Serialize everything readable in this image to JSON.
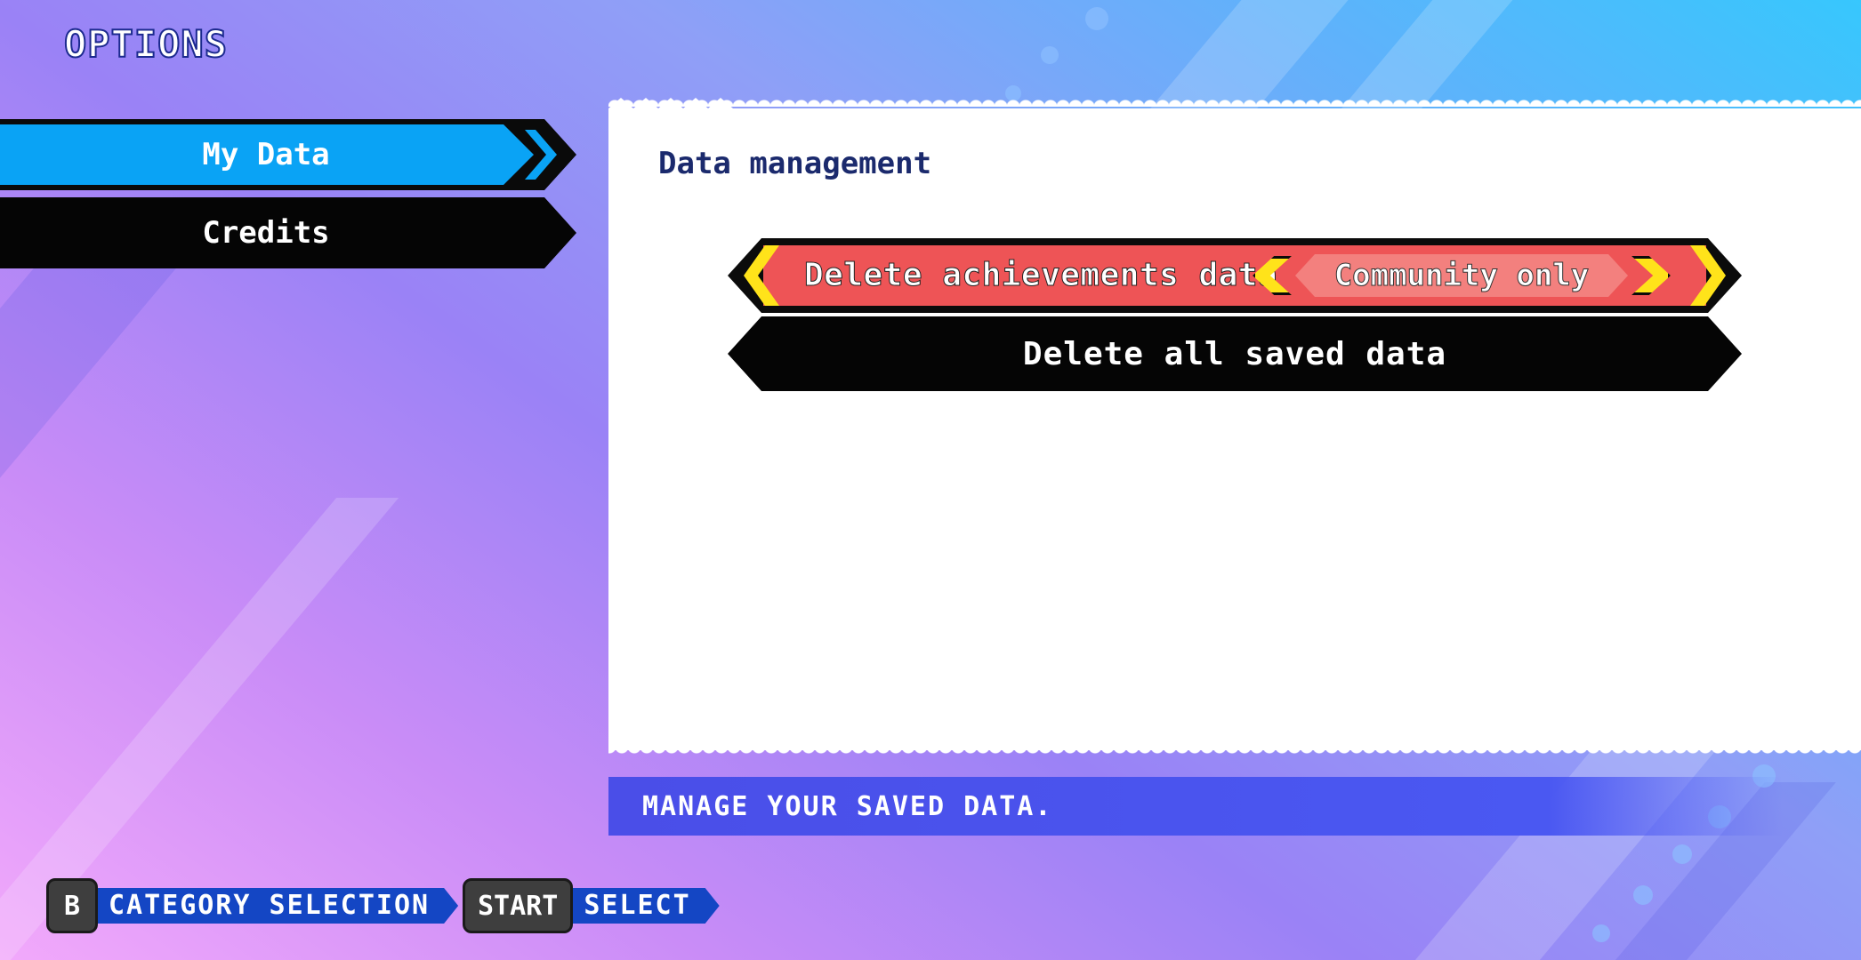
{
  "header": {
    "title": "OPTIONS"
  },
  "sidebar": {
    "items": [
      {
        "label": "My Data",
        "selected": true
      },
      {
        "label": "Credits",
        "selected": false
      }
    ]
  },
  "panel": {
    "section_title": "Data management",
    "rows": [
      {
        "label": "Delete achievements data",
        "value": "Community only",
        "selected": true
      },
      {
        "label": "Delete all saved data",
        "selected": false
      }
    ]
  },
  "hint": {
    "text": "MANAGE YOUR SAVED DATA."
  },
  "controls": [
    {
      "key": "B",
      "action": "CATEGORY SELECTION"
    },
    {
      "key": "START",
      "action": "SELECT"
    }
  ],
  "colors": {
    "selected_tab": "#0aa3f5",
    "selected_row": "#ee5456",
    "value_pill": "#f3807e",
    "arrow_yellow": "#ffe31a",
    "hint_bar": "#4a58f2",
    "control_label": "#1446c4"
  }
}
